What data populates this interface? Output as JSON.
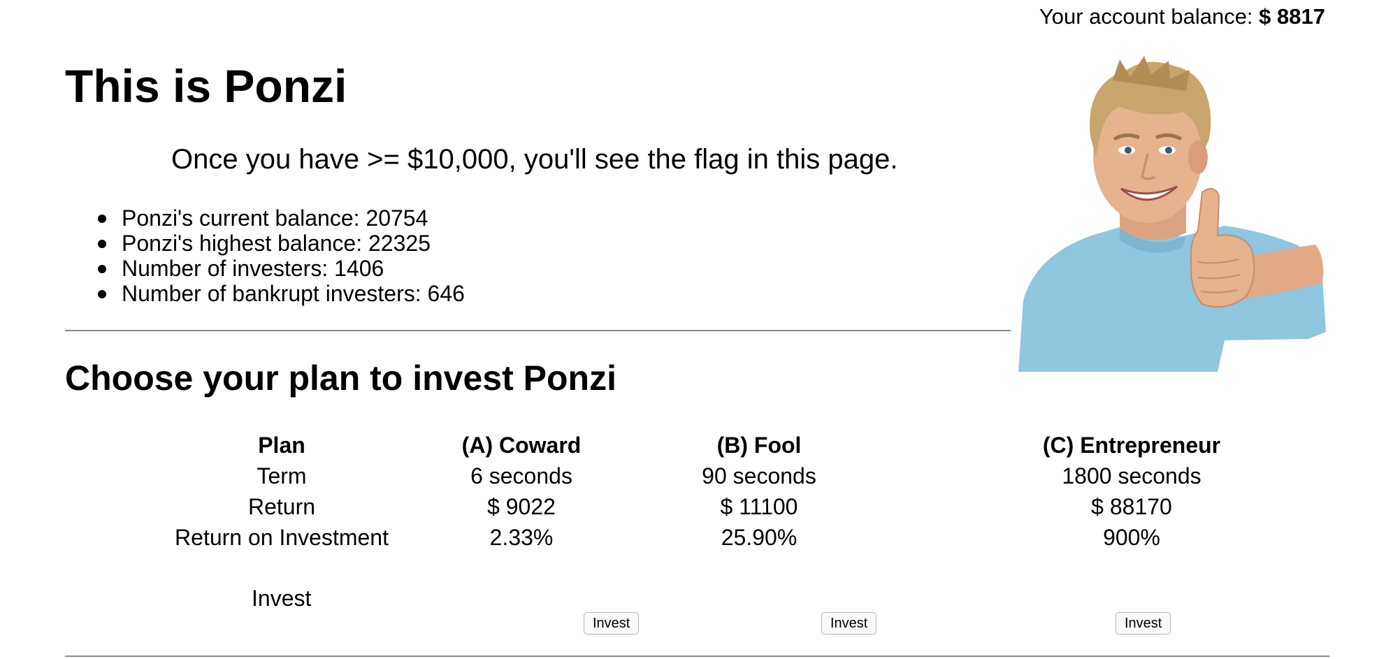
{
  "account": {
    "label": "Your account balance:",
    "amount": "$ 8817"
  },
  "header": {
    "title": "This is Ponzi",
    "hint": "Once you have >= $10,000, you'll see the flag in this page."
  },
  "stats": [
    "Ponzi's current balance: 20754",
    "Ponzi's highest balance: 22325",
    "Number of investers: 1406",
    "Number of bankrupt investers: 646"
  ],
  "plans_section": {
    "title": "Choose your plan to invest Ponzi",
    "header": [
      "Plan",
      "(A) Coward",
      "(B) Fool",
      "(C) Entrepreneur"
    ],
    "rows": [
      [
        "Term",
        "6 seconds",
        "90 seconds",
        "1800 seconds"
      ],
      [
        "Return",
        "$ 9022",
        "$ 11100",
        "$ 88170"
      ],
      [
        "Return on Investment",
        "2.33%",
        "25.90%",
        "900%"
      ]
    ],
    "invest_label": "Invest",
    "buttons": [
      "Invest",
      "Invest",
      "Invest"
    ]
  },
  "image": {
    "subject": "smiling man in light blue t-shirt giving thumbs up"
  },
  "colors": {
    "shirt": "#8fc6e0",
    "skin": "#e7b28e",
    "hair": "#c9a46c",
    "rule": "#8a8a8a"
  }
}
